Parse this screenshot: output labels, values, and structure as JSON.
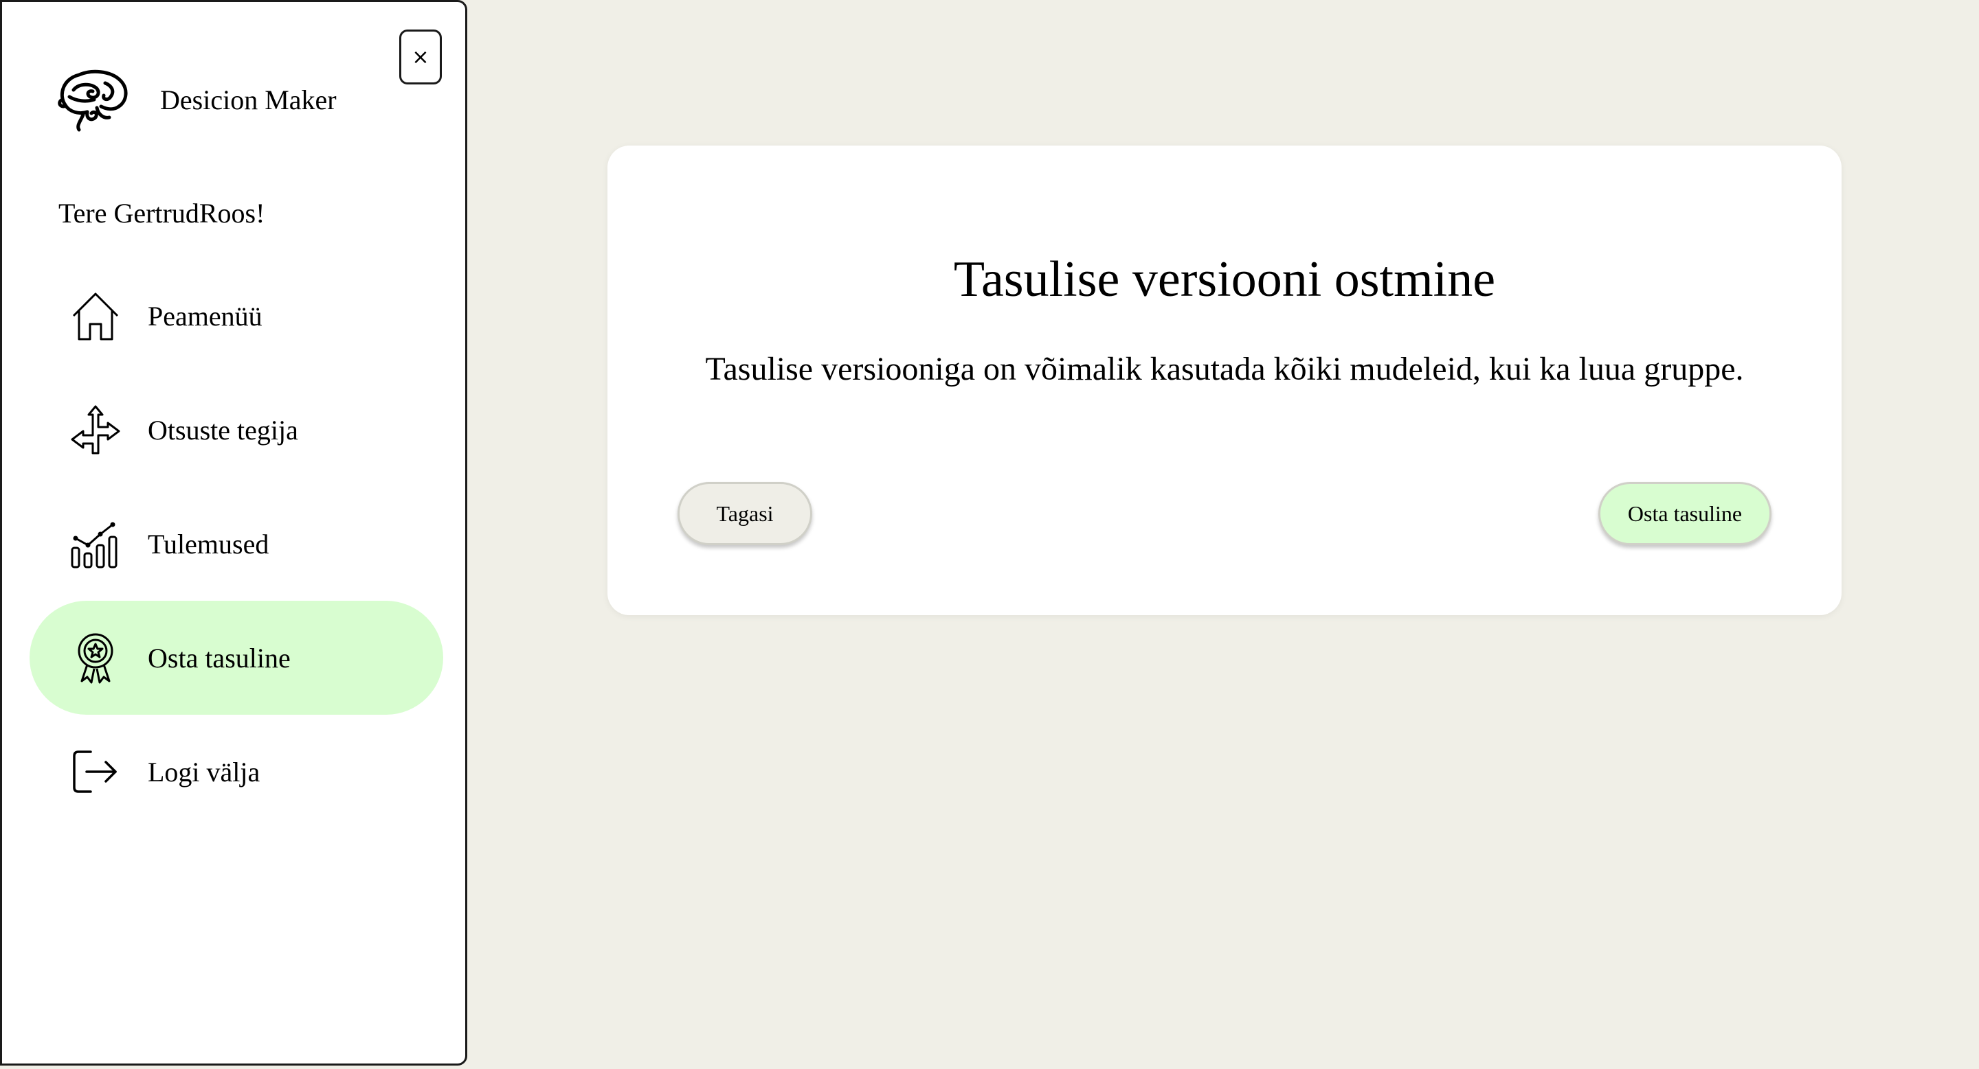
{
  "sidebar": {
    "close_label": "×",
    "brand_name": "Desicion Maker",
    "greeting": "Tere GertrudRoos!",
    "items": [
      {
        "label": "Peamenüü",
        "icon": "home-icon",
        "active": false
      },
      {
        "label": "Otsuste tegija",
        "icon": "directions-arrows-icon",
        "active": false
      },
      {
        "label": "Tulemused",
        "icon": "bar-chart-icon",
        "active": false
      },
      {
        "label": "Osta tasuline",
        "icon": "award-badge-icon",
        "active": true
      },
      {
        "label": "Logi välja",
        "icon": "logout-icon",
        "active": false
      }
    ]
  },
  "dialog": {
    "title": "Tasulise versiooni ostmine",
    "text": "Tasulise versiooniga on võimalik kasutada kõiki mudeleid, kui ka luua gruppe.",
    "back_label": "Tagasi",
    "buy_label": "Osta tasuline"
  },
  "colors": {
    "background": "#f0efe7",
    "accent_green": "#d8fdd0",
    "panel": "#ffffff"
  }
}
